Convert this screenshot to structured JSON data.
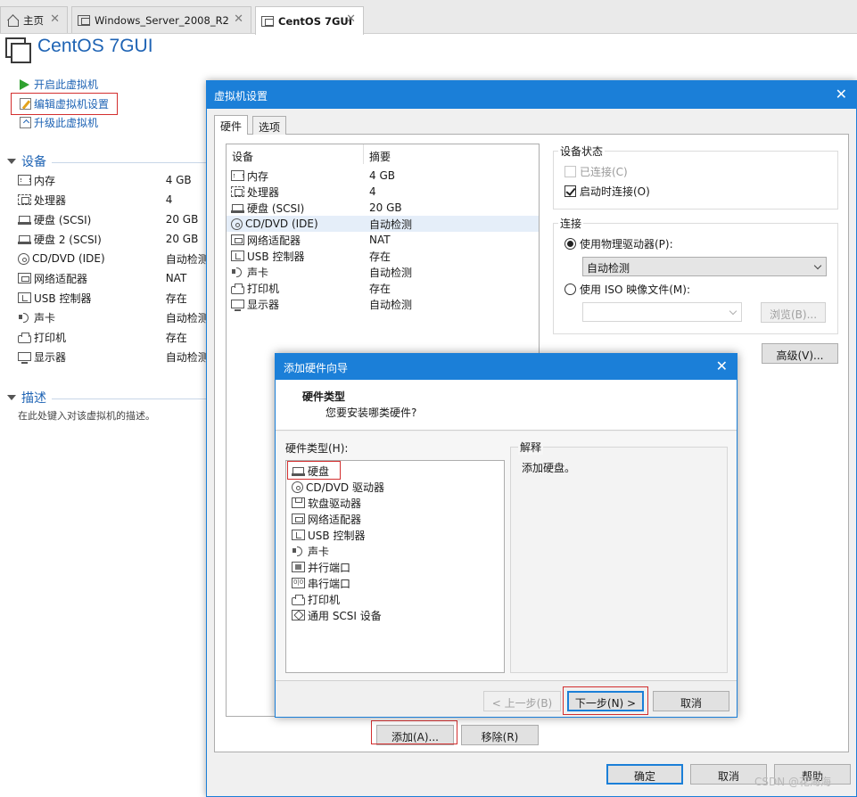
{
  "tabs": [
    {
      "label": "主页",
      "icon": "home-icon",
      "active": false
    },
    {
      "label": "Windows_Server_2008_R2",
      "icon": "vm-icon",
      "active": false
    },
    {
      "label": "CentOS 7GUI",
      "icon": "vm-icon",
      "active": true
    }
  ],
  "vm": {
    "title": "CentOS 7GUI",
    "actions": {
      "power_on": "开启此虚拟机",
      "edit_settings": "编辑虚拟机设置",
      "upgrade": "升级此虚拟机"
    },
    "devices_heading": "设备",
    "devices": [
      {
        "name": "内存",
        "value": "4 GB",
        "icon": "memory-icon"
      },
      {
        "name": "处理器",
        "value": "4",
        "icon": "processor-icon"
      },
      {
        "name": "硬盘 (SCSI)",
        "value": "20 GB",
        "icon": "hard-disk-icon"
      },
      {
        "name": "硬盘 2 (SCSI)",
        "value": "20 GB",
        "icon": "hard-disk-icon"
      },
      {
        "name": "CD/DVD (IDE)",
        "value": "自动检测",
        "icon": "cd-dvd-icon"
      },
      {
        "name": "网络适配器",
        "value": "NAT",
        "icon": "network-adapter-icon"
      },
      {
        "name": "USB 控制器",
        "value": "存在",
        "icon": "usb-icon"
      },
      {
        "name": "声卡",
        "value": "自动检测",
        "icon": "sound-card-icon"
      },
      {
        "name": "打印机",
        "value": "存在",
        "icon": "printer-icon"
      },
      {
        "name": "显示器",
        "value": "自动检测",
        "icon": "display-icon"
      }
    ],
    "description_heading": "描述",
    "description_placeholder": "在此处键入对该虚拟机的描述。"
  },
  "settings_dialog": {
    "title": "虚拟机设置",
    "tabs": [
      "硬件",
      "选项"
    ],
    "table_headers": [
      "设备",
      "摘要"
    ],
    "devices": [
      {
        "name": "内存",
        "summary": "4 GB",
        "icon": "memory-icon"
      },
      {
        "name": "处理器",
        "summary": "4",
        "icon": "processor-icon"
      },
      {
        "name": "硬盘 (SCSI)",
        "summary": "20 GB",
        "icon": "hard-disk-icon"
      },
      {
        "name": "CD/DVD (IDE)",
        "summary": "自动检测",
        "icon": "cd-dvd-icon",
        "selected": true
      },
      {
        "name": "网络适配器",
        "summary": "NAT",
        "icon": "network-adapter-icon"
      },
      {
        "name": "USB 控制器",
        "summary": "存在",
        "icon": "usb-icon"
      },
      {
        "name": "声卡",
        "summary": "自动检测",
        "icon": "sound-card-icon"
      },
      {
        "name": "打印机",
        "summary": "存在",
        "icon": "printer-icon"
      },
      {
        "name": "显示器",
        "summary": "自动检测",
        "icon": "display-icon"
      }
    ],
    "device_status": {
      "title": "设备状态",
      "connected": "已连接(C)",
      "connected_checked": false,
      "connect_at_power_on": "启动时连接(O)",
      "connect_at_power_on_checked": true
    },
    "connection": {
      "title": "连接",
      "physical_drive": "使用物理驱动器(P):",
      "physical_drive_selected": true,
      "physical_drive_value": "自动检测",
      "iso_image": "使用 ISO 映像文件(M):",
      "iso_value": "",
      "browse": "浏览(B)..."
    },
    "advanced": "高级(V)...",
    "add": "添加(A)...",
    "remove": "移除(R)",
    "ok": "确定",
    "cancel": "取消",
    "help": "帮助"
  },
  "wizard": {
    "title": "添加硬件向导",
    "heading": "硬件类型",
    "subheading": "您要安装哪类硬件?",
    "list_label": "硬件类型(H):",
    "hardware_types": [
      {
        "label": "硬盘",
        "icon": "hard-disk-icon",
        "selected": true
      },
      {
        "label": "CD/DVD 驱动器",
        "icon": "cd-dvd-icon"
      },
      {
        "label": "软盘驱动器",
        "icon": "floppy-icon"
      },
      {
        "label": "网络适配器",
        "icon": "network-adapter-icon"
      },
      {
        "label": "USB 控制器",
        "icon": "usb-icon"
      },
      {
        "label": "声卡",
        "icon": "sound-card-icon"
      },
      {
        "label": "并行端口",
        "icon": "parallel-port-icon"
      },
      {
        "label": "串行端口",
        "icon": "serial-port-icon"
      },
      {
        "label": "打印机",
        "icon": "printer-icon"
      },
      {
        "label": "通用 SCSI 设备",
        "icon": "generic-scsi-icon"
      }
    ],
    "explanation_title": "解释",
    "explanation_text": "添加硬盘。",
    "back": "< 上一步(B)",
    "next": "下一步(N) >",
    "cancel": "取消"
  },
  "watermark": "CSDN @花海海",
  "colors": {
    "accent": "#1b7fd8",
    "link": "#1e63b4",
    "highlight_red": "#d32f2f"
  }
}
